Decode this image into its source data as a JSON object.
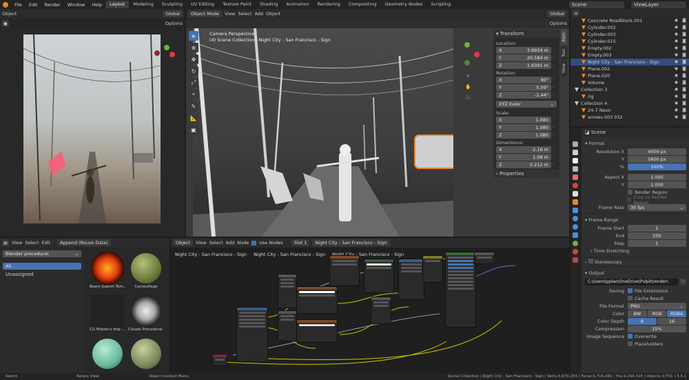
{
  "topbar": {
    "menus": [
      "File",
      "Edit",
      "Render",
      "Window",
      "Help"
    ],
    "workspaces": [
      "Layout",
      "Modeling",
      "Sculpting",
      "UV Editing",
      "Texture Paint",
      "Shading",
      "Animation",
      "Rendering",
      "Compositing",
      "Geometry Nodes",
      "Scripting"
    ],
    "active_workspace": "Layout",
    "scene": "Scene",
    "view_layer": "ViewLayer"
  },
  "image_editor": {
    "header_left": "Object",
    "orientation": "Global",
    "options": "Options"
  },
  "viewport": {
    "mode": "Object Mode",
    "menus": [
      "View",
      "Select",
      "Add",
      "Object"
    ],
    "orientation": "Global",
    "options": "Options",
    "overlay_line1": "Camera Perspective",
    "overlay_line2": "(4) Scene Collection | Night City - San Francisco - Sign",
    "side_tabs": [
      "Item",
      "Tool",
      "View"
    ]
  },
  "transform_panel": {
    "title": "Transform",
    "location_label": "Location:",
    "location": [
      {
        "axis": "X",
        "value": "3.8934 m"
      },
      {
        "axis": "Y",
        "value": "20.584 m"
      },
      {
        "axis": "Z",
        "value": "1.9391 m"
      }
    ],
    "rotation_label": "Rotation:",
    "rotation": [
      {
        "axis": "X",
        "value": "90°"
      },
      {
        "axis": "Y",
        "value": "5.09°"
      },
      {
        "axis": "Z",
        "value": "-2.44°"
      }
    ],
    "rotation_mode": "XYZ Euler",
    "scale_label": "Scale:",
    "scale": [
      {
        "axis": "X",
        "value": "1.080"
      },
      {
        "axis": "Y",
        "value": "1.080"
      },
      {
        "axis": "Z",
        "value": "1.080"
      }
    ],
    "dimensions_label": "Dimensions:",
    "dimensions": [
      {
        "axis": "X",
        "value": "2.16 m"
      },
      {
        "axis": "Y",
        "value": "1.08 m"
      },
      {
        "axis": "Z",
        "value": "0.212 m"
      }
    ],
    "properties_label": "Properties"
  },
  "outliner": {
    "rows": [
      {
        "name": "Concrete Roadblock.001",
        "indent": 1,
        "selected": false
      },
      {
        "name": "Cylinder.002",
        "indent": 1,
        "selected": false
      },
      {
        "name": "Cylinder.003",
        "indent": 1,
        "selected": false
      },
      {
        "name": "Cylinder.015",
        "indent": 1,
        "selected": false
      },
      {
        "name": "Empty.002",
        "indent": 1,
        "selected": false
      },
      {
        "name": "Empty.003",
        "indent": 1,
        "selected": false
      },
      {
        "name": "Night City - San Francisco - Sign",
        "indent": 1,
        "selected": true
      },
      {
        "name": "Plane.002",
        "indent": 1,
        "selected": false
      },
      {
        "name": "Plane.020",
        "indent": 1,
        "selected": false
      },
      {
        "name": "Volume",
        "indent": 1,
        "selected": false
      },
      {
        "name": "Collection 3",
        "indent": 0,
        "selected": false
      },
      {
        "name": "rig",
        "indent": 1,
        "selected": false
      },
      {
        "name": "Collection 4",
        "indent": 0,
        "selected": false
      },
      {
        "name": "24-7 Neon",
        "indent": 1,
        "selected": false
      },
      {
        "name": "arrows.003 032",
        "indent": 1,
        "selected": false
      }
    ]
  },
  "properties": {
    "context": "Scene",
    "format": {
      "title": "Format",
      "res_x_label": "Resolution X",
      "res_x": "4000 px",
      "res_y_label": "Y",
      "res_y": "5600 px",
      "res_pct_label": "%",
      "res_pct": "100%",
      "aspect_x_label": "Aspect X",
      "aspect_x": "1.000",
      "aspect_y_label": "Y",
      "aspect_y": "1.000",
      "render_region": "Render Region",
      "crop": "Crop to Render Region",
      "frame_rate_label": "Frame Rate",
      "frame_rate": "30 fps"
    },
    "frame_range": {
      "title": "Frame Range",
      "start_label": "Frame Start",
      "start": "1",
      "end_label": "End",
      "end": "250",
      "step_label": "Step",
      "step": "1",
      "time_stretching": "Time Stretching"
    },
    "stereoscopy": "Stereoscopy",
    "output": {
      "title": "Output",
      "path": "C:\\Users\\pplao\\OneDrive\\Pulpit\\render\\",
      "saving_label": "Saving",
      "file_extensions": "File Extensions",
      "cache_result": "Cache Result",
      "file_format_label": "File Format",
      "file_format": "PNG",
      "color_label": "Color",
      "color_options": [
        "BW",
        "RGB",
        "RGBA"
      ],
      "color_active": "RGBA",
      "depth_label": "Color Depth",
      "depth_options": [
        "8",
        "16"
      ],
      "depth_active": "8",
      "compression_label": "Compression",
      "compression": "15%",
      "image_seq_label": "Image Sequence",
      "overwrite": "Overwrite",
      "placeholders": "Placeholders"
    }
  },
  "material_browser": {
    "menus": [
      "View",
      "Select",
      "Edit"
    ],
    "dropdown": "Append (Reuse Data)",
    "library": "Blender procedural",
    "catalogs": [
      "All",
      "Unassigned"
    ],
    "assets": [
      "Beam Joakim Tom...",
      "Camouflage",
      "CG Matter's drip ...",
      "Clouds Procedural ...",
      "",
      ""
    ]
  },
  "node_editor": {
    "type": "Object",
    "menus": [
      "View",
      "Select",
      "Add",
      "Node"
    ],
    "use_nodes": "Use Nodes",
    "slot": "Slot 1",
    "material": "Night City - San Francisco - Sign",
    "breadcrumbs": [
      "Night City - San Francisco - Sign",
      "Night City - San Francisco - Sign",
      "Night City - San Francisco - Sign"
    ]
  },
  "statusbar": {
    "left": [
      "Select",
      "Rotate View",
      "Object Context Menu"
    ],
    "right": "Scene Collection | Night City - San Francisco - Sign | Verts:4,670,293 | Faces:4,716,965 | Tris:9,244,318 | Objects:1/701 | 3.3.1"
  },
  "colors": {
    "accent": "#4772b3",
    "orange": "#e8872b",
    "x_axis": "#e23a4a",
    "y_axis": "#6ab23a",
    "z_axis": "#3a7ae2"
  }
}
